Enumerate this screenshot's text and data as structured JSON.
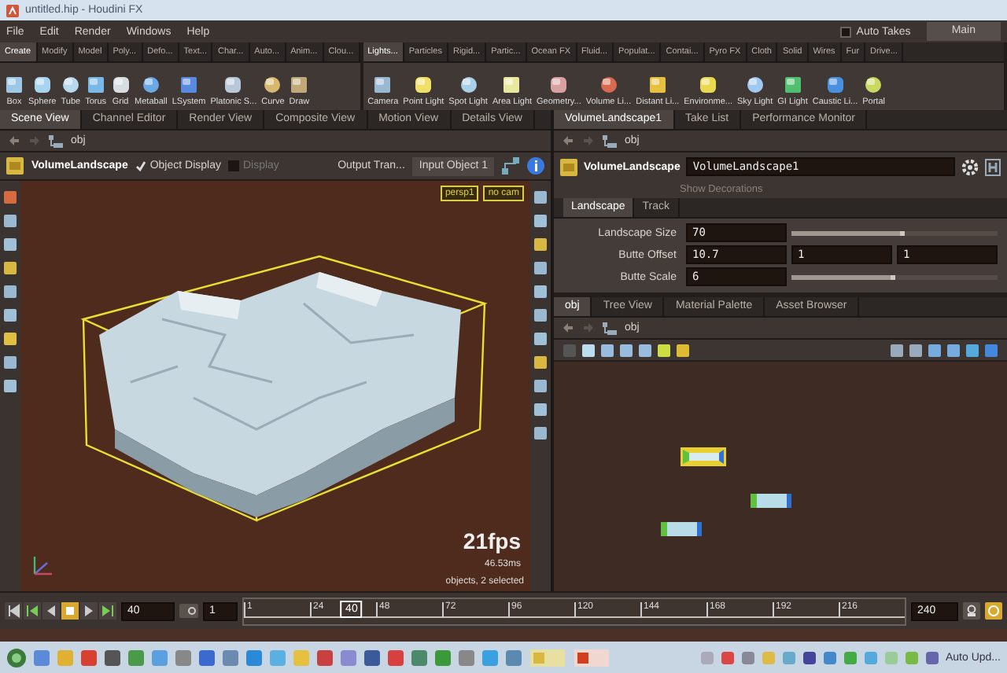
{
  "window": {
    "title": "untitled.hip - Houdini FX"
  },
  "menu": [
    "File",
    "Edit",
    "Render",
    "Windows",
    "Help"
  ],
  "auto_takes": {
    "label": "Auto Takes",
    "checked": false
  },
  "desktop": "Main",
  "shelves": [
    {
      "tabs": [
        {
          "label": "Create",
          "selected": true
        },
        {
          "label": "Modify",
          "selected": false
        },
        {
          "label": "Model",
          "selected": false
        },
        {
          "label": "Poly...",
          "selected": false
        },
        {
          "label": "Defo...",
          "selected": false
        },
        {
          "label": "Text...",
          "selected": false
        },
        {
          "label": "Char...",
          "selected": false
        },
        {
          "label": "Auto...",
          "selected": false
        },
        {
          "label": "Anim...",
          "selected": false
        },
        {
          "label": "Clou...",
          "selected": false
        }
      ],
      "tools": [
        "Box",
        "Sphere",
        "Tube",
        "Torus",
        "Grid",
        "Metaball",
        "LSystem",
        "Platonic S...",
        "Curve",
        "Draw"
      ]
    },
    {
      "tabs": [
        {
          "label": "Lights...",
          "selected": true
        },
        {
          "label": "Particles",
          "selected": false
        },
        {
          "label": "Rigid...",
          "selected": false
        },
        {
          "label": "Partic...",
          "selected": false
        },
        {
          "label": "Ocean FX",
          "selected": false
        },
        {
          "label": "Fluid...",
          "selected": false
        },
        {
          "label": "Populat...",
          "selected": false
        },
        {
          "label": "Contai...",
          "selected": false
        },
        {
          "label": "Pyro FX",
          "selected": false
        },
        {
          "label": "Cloth",
          "selected": false
        },
        {
          "label": "Solid",
          "selected": false
        },
        {
          "label": "Wires",
          "selected": false
        },
        {
          "label": "Fur",
          "selected": false
        },
        {
          "label": "Drive...",
          "selected": false
        }
      ],
      "tools": [
        "Camera",
        "Point Light",
        "Spot Light",
        "Area Light",
        "Geometry...",
        "Volume Li...",
        "Distant Li...",
        "Environme...",
        "Sky Light",
        "GI Light",
        "Caustic Li...",
        "Portal"
      ]
    }
  ],
  "scene_view": {
    "tabs": [
      {
        "label": "Scene View",
        "selected": true
      },
      {
        "label": "Channel Editor",
        "selected": false
      },
      {
        "label": "Render View",
        "selected": false
      },
      {
        "label": "Composite View",
        "selected": false
      },
      {
        "label": "Motion View",
        "selected": false
      },
      {
        "label": "Details View",
        "selected": false
      }
    ],
    "path": "obj",
    "node": "VolumeLandscape",
    "object_display": {
      "label": "Object Display",
      "checked": true
    },
    "display": {
      "label": "Display",
      "checked": false
    },
    "output": "Output Tran...",
    "input": "Input Object 1",
    "camera": "persp1",
    "cam_menu": "no cam",
    "fps": "21fps",
    "time": "46.53ms",
    "selection": "objects, 2 selected"
  },
  "parameters": {
    "tabs": [
      {
        "label": "VolumeLandscape1",
        "selected": true
      },
      {
        "label": "Take List",
        "selected": false
      },
      {
        "label": "Performance Monitor",
        "selected": false
      }
    ],
    "path": "obj",
    "node_type": "VolumeLandscape",
    "node_name": "VolumeLandscape1",
    "show_decorations": "Show Decorations",
    "folders": [
      {
        "label": "Landscape",
        "selected": true
      },
      {
        "label": "Track",
        "selected": false
      }
    ],
    "params": [
      {
        "kind": "slider",
        "label": "Landscape Size",
        "value": "70",
        "level": 0.55
      },
      {
        "kind": "vector",
        "label": "Butte Offset",
        "values": [
          "10.7",
          "1",
          "1"
        ]
      },
      {
        "kind": "slider",
        "label": "Butte Scale",
        "value": "6",
        "level": 0.5
      }
    ]
  },
  "network": {
    "tabs": [
      {
        "label": "obj",
        "selected": true
      },
      {
        "label": "Tree View",
        "selected": false
      },
      {
        "label": "Material Palette",
        "selected": false
      },
      {
        "label": "Asset Browser",
        "selected": false
      }
    ],
    "path": "obj",
    "nodes": [
      {
        "selected": true
      },
      {
        "selected": false
      },
      {
        "selected": false
      }
    ]
  },
  "timeline": {
    "frame": "40",
    "step": "1",
    "ticks": [
      "1",
      "24",
      "48",
      "72",
      "96",
      "120",
      "144",
      "168",
      "192",
      "216"
    ],
    "current": "40",
    "level": 0.163,
    "end": "240"
  },
  "taskbar": {
    "tray_text": "Auto Upd..."
  }
}
